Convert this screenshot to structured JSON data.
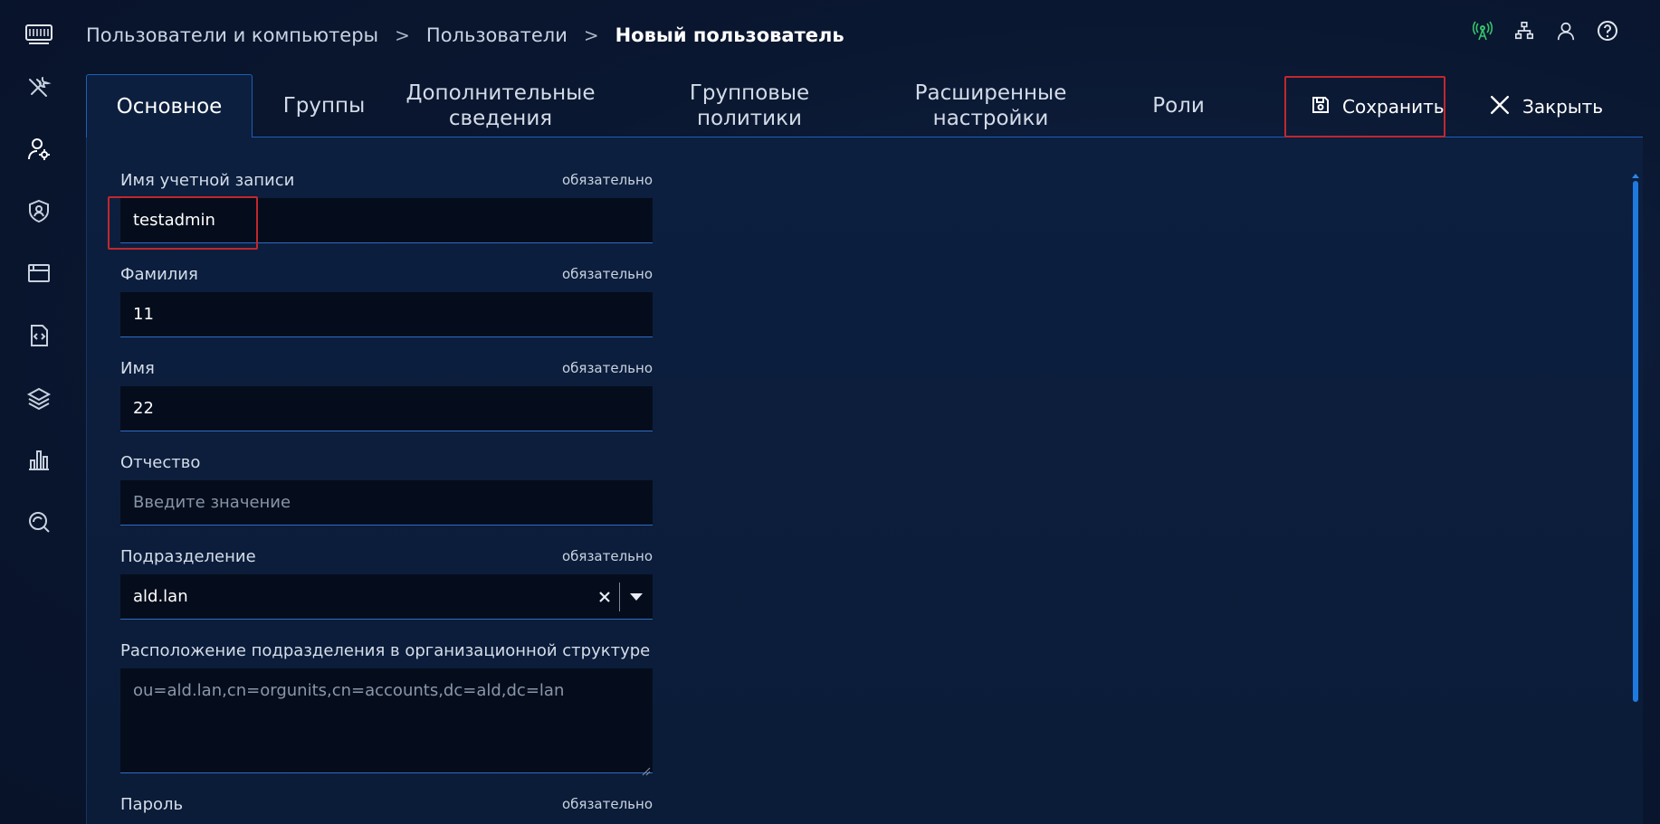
{
  "breadcrumb": {
    "items": [
      "Пользователи и компьютеры",
      "Пользователи"
    ],
    "separator": ">",
    "current": "Новый пользователь"
  },
  "top_icons": [
    "network-status-icon",
    "hierarchy-icon",
    "user-icon",
    "help-icon"
  ],
  "tabs": [
    {
      "label": "Основное",
      "active": true
    },
    {
      "label": "Группы"
    },
    {
      "label": "Дополнительные\nсведения"
    },
    {
      "label": "Групповые\nполитики"
    },
    {
      "label": "Расширенные\nнастройки"
    },
    {
      "label": "Роли"
    }
  ],
  "actions": {
    "save_label": "Сохранить",
    "close_label": "Закрыть"
  },
  "form": {
    "required_label": "обязательно",
    "account_name": {
      "label": "Имя учетной записи",
      "value": "testadmin"
    },
    "last_name": {
      "label": "Фамилия",
      "value": "11"
    },
    "first_name": {
      "label": "Имя",
      "value": "22"
    },
    "middle_name": {
      "label": "Отчество",
      "placeholder": "Введите значение"
    },
    "division": {
      "label": "Подразделение",
      "value": "ald.lan"
    },
    "division_location": {
      "label": "Расположение подразделения в организационной структуре",
      "value": "ou=ald.lan,cn=orgunits,cn=accounts,dc=ald,dc=lan"
    },
    "password": {
      "label": "Пароль"
    }
  },
  "colors": {
    "accent": "#1f7ae0",
    "highlight": "#c0282d",
    "status_green": "#35c46a"
  }
}
